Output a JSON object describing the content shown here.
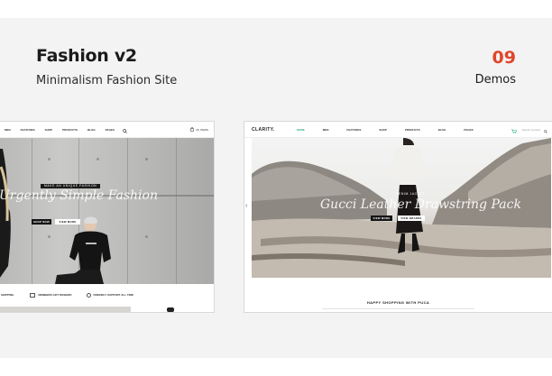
{
  "header": {
    "title": "Fashion v2",
    "subtitle": "Minimalism Fashion Site",
    "demo_count": "09",
    "demo_label": "Demos"
  },
  "demo_left": {
    "nav": [
      "MEN",
      "FEATURES",
      "SHOP",
      "PRODUCTS",
      "BLOG",
      "PAGES"
    ],
    "nav_right": "(0) Items",
    "badge": "MAKE AN UNIQUE FASHION",
    "headline": "Urgently Simple Fashion",
    "buttons": [
      "SHOP NOW",
      "VIEW MORE"
    ],
    "features": [
      "SHIPPING",
      "MEMBERS GIFT REWARD",
      "FRIENDLY SUPPORT ALL TIME"
    ]
  },
  "demo_right": {
    "logo": "CLARITY.",
    "nav": [
      "HOME",
      "MEN",
      "FEATURES",
      "SHOP",
      "PRODUCTS",
      "BLOG",
      "PAGES"
    ],
    "search_placeholder": "Search product",
    "subheading": "DENIM JACKET",
    "headline": "Gucci Leather Drawstring Pack",
    "buttons": [
      "VIEW MORE",
      "VIEW BRANDS"
    ],
    "tagline": "HAPPY SHOPPING WITH PUCA"
  },
  "colors": {
    "accent": "#e0462a",
    "nav_active": "#2eae79",
    "panel_bg": "#f3f3f3"
  }
}
